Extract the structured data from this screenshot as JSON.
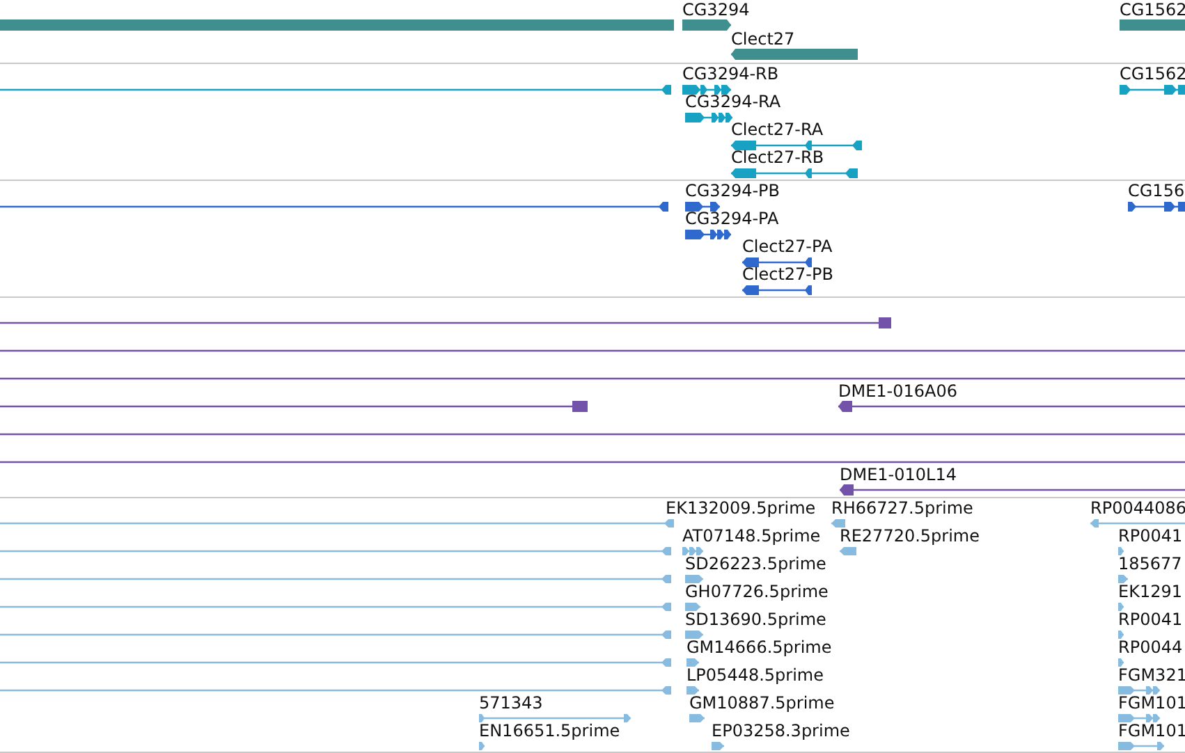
{
  "tracks": [
    {
      "color": "#3f8f8f",
      "features": [
        {
          "points_right": false
        },
        {
          "label": "CG3294",
          "points_left": false,
          "points_right": true
        },
        {
          "label": "Clect27",
          "points_left": true,
          "points_right": false
        },
        {
          "label": "CG1562",
          "points_left": false
        }
      ]
    },
    {
      "color": "#17a2c4",
      "features": [
        {
          "points_left": true,
          "points_right": false
        },
        {
          "label": "CG3294-RB",
          "points_left": false,
          "points_right": true
        },
        {
          "label": "CG1562",
          "points_left": false,
          "points_right": true
        },
        {
          "label": "CG3294-RA",
          "points_left": false,
          "points_right": true
        },
        {
          "label": "Clect27-RA",
          "points_left": true,
          "points_right": false
        },
        {
          "label": "Clect27-RB",
          "points_left": true,
          "points_right": false
        }
      ]
    },
    {
      "color": "#2f69cd",
      "features": [
        {
          "points_left": true,
          "points_right": false
        },
        {
          "label": "CG3294-PB",
          "points_left": false,
          "points_right": true
        },
        {
          "label": "CG156",
          "points_left": false,
          "points_right": true
        },
        {
          "label": "CG3294-PA",
          "points_left": false,
          "points_right": true
        },
        {
          "label": "Clect27-PA",
          "points_left": true,
          "points_right": false
        },
        {
          "label": "Clect27-PB",
          "points_left": true,
          "points_right": false
        }
      ]
    },
    {
      "color": "#7352a9",
      "features": [
        {
          "points_left": false,
          "points_right": false
        },
        {
          "points_left": false,
          "points_right": false
        },
        {
          "label": "DME1-016A06",
          "points_left": true,
          "points_right": false
        },
        {
          "label": "DME1-010L14",
          "points_left": true,
          "points_right": false
        }
      ]
    },
    {
      "color": "#88bbe0",
      "features": [
        {
          "label": "EK132009.5prime",
          "points_left": true,
          "points_right": false
        },
        {
          "label": "RH66727.5prime",
          "points_left": true,
          "points_right": false
        },
        {
          "label": "RP0044086",
          "points_left": true,
          "points_right": false
        },
        {
          "points_left": true,
          "points_right": false
        },
        {
          "label": "AT07148.5prime",
          "points_left": false,
          "points_right": true
        },
        {
          "label": "RE27720.5prime",
          "points_left": true,
          "points_right": false
        },
        {
          "label": "RP0041",
          "points_left": false,
          "points_right": true
        },
        {
          "points_left": true,
          "points_right": false
        },
        {
          "label": "SD26223.5prime",
          "points_left": false,
          "points_right": true
        },
        {
          "label": "185677",
          "points_left": false,
          "points_right": true
        },
        {
          "points_left": true,
          "points_right": false
        },
        {
          "label": "GH07726.5prime",
          "points_left": false,
          "points_right": true
        },
        {
          "label": "EK1291",
          "points_left": false,
          "points_right": true
        },
        {
          "points_left": true,
          "points_right": false
        },
        {
          "label": "SD13690.5prime",
          "points_left": false,
          "points_right": true
        },
        {
          "label": "RP0041",
          "points_left": false,
          "points_right": true
        },
        {
          "points_left": true,
          "points_right": false
        },
        {
          "label": "GM14666.5prime",
          "points_left": false,
          "points_right": true
        },
        {
          "label": "RP0044",
          "points_left": false,
          "points_right": true
        },
        {
          "points_left": true,
          "points_right": false
        },
        {
          "label": "LP05448.5prime",
          "points_left": false,
          "points_right": true
        },
        {
          "label": "FGM321",
          "points_left": false,
          "points_right": true
        },
        {
          "label": "571343",
          "points_left": false,
          "points_right": true
        },
        {
          "label": "GM10887.5prime",
          "points_left": false,
          "points_right": true
        },
        {
          "label": "FGM101",
          "points_left": false,
          "points_right": true
        },
        {
          "label": "EN16651.5prime",
          "points_left": false,
          "points_right": true
        },
        {
          "label": "EP03258.3prime",
          "points_left": false,
          "points_right": true
        },
        {
          "label": "FGM101",
          "points_left": false,
          "points_right": true
        }
      ]
    }
  ]
}
